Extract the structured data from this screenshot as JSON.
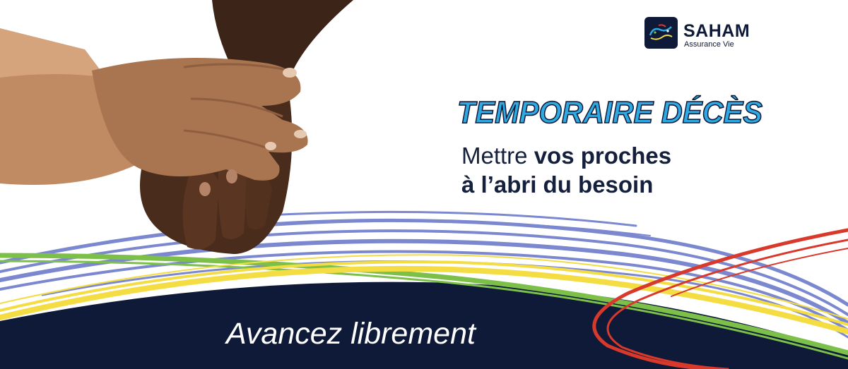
{
  "brand": {
    "name": "SAHAM",
    "subtitle": "Assurance Vie",
    "logo_icon": "saham-logo-icon",
    "logo_bg": "#0e1a38"
  },
  "product": {
    "title": "TEMPORAIRE DÉCÈS",
    "title_color": "#2fa9e1"
  },
  "tagline": {
    "line1_plain": "Mettre",
    "line1_bold": "vos proches",
    "line2": "à l’abri du besoin"
  },
  "slogan": "Avancez librement",
  "colors": {
    "navy": "#0e1a38",
    "blue_stripes": "#7b88cf",
    "green_stripe": "#7cc04a",
    "yellow_stripe": "#f3dd43",
    "red_stripe": "#d8392b",
    "skin_light": "#b07a52",
    "skin_dark": "#3d2418"
  },
  "photo": {
    "icon": "holding-hands-photo"
  }
}
